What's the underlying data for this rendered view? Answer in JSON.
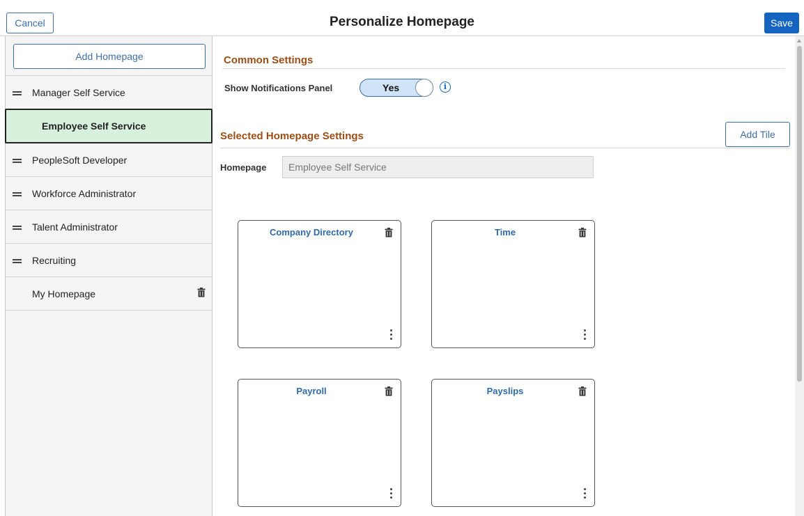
{
  "header": {
    "cancel_label": "Cancel",
    "title": "Personalize Homepage",
    "save_label": "Save"
  },
  "sidebar": {
    "add_homepage_label": "Add Homepage",
    "items": [
      {
        "label": "Manager Self Service"
      },
      {
        "label": "Employee Self Service",
        "selected": true
      },
      {
        "label": "PeopleSoft Developer"
      },
      {
        "label": "Workforce Administrator"
      },
      {
        "label": "Talent Administrator"
      },
      {
        "label": "Recruiting"
      },
      {
        "label": "My Homepage",
        "deletable": true
      }
    ]
  },
  "common_settings": {
    "heading": "Common Settings",
    "notifications_label": "Show Notifications Panel",
    "notifications_value": "Yes"
  },
  "selected_settings": {
    "heading": "Selected Homepage Settings",
    "add_tile_label": "Add Tile",
    "homepage_label": "Homepage",
    "homepage_value": "Employee Self Service"
  },
  "tiles": [
    {
      "title": "Company Directory"
    },
    {
      "title": "Time"
    },
    {
      "title": "Payroll"
    },
    {
      "title": "Payslips"
    }
  ],
  "icons": {
    "drag": "drag-handle-icon",
    "trash": "trash-icon",
    "info": "info-icon",
    "more": "more-vertical-icon"
  },
  "colors": {
    "accent": "#1565c0",
    "heading": "#9c4e16",
    "selected_bg": "#d8f1dd",
    "tile_title": "#2f6aa8"
  }
}
